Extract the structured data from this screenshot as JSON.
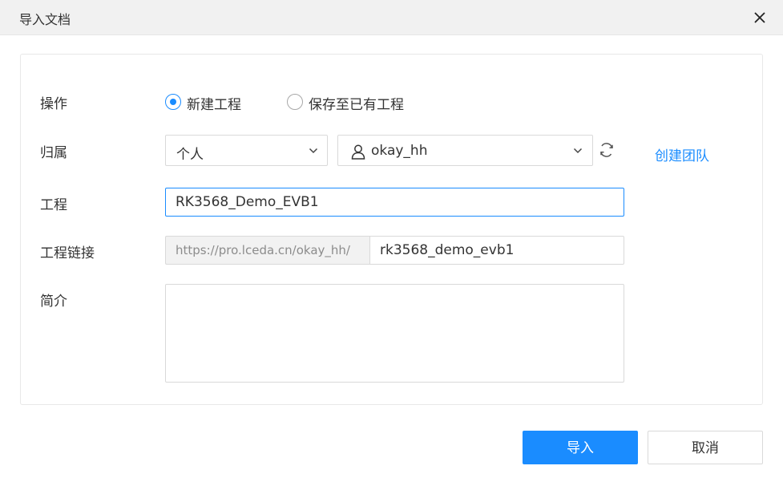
{
  "dialog": {
    "title": "导入文档",
    "close_icon": "close-icon"
  },
  "form": {
    "operation": {
      "label": "操作",
      "options": [
        {
          "label": "新建工程",
          "checked": true
        },
        {
          "label": "保存至已有工程",
          "checked": false
        }
      ]
    },
    "owner": {
      "label": "归属",
      "scope_value": "个人",
      "user_value": "okay_hh",
      "user_icon": "user-icon",
      "refresh_icon": "refresh-icon",
      "create_team_link": "创建团队"
    },
    "project": {
      "label": "工程",
      "value": "RK3568_Demo_EVB1"
    },
    "project_link": {
      "label": "工程链接",
      "prefix": "https://pro.lceda.cn/okay_hh/",
      "value": "rk3568_demo_evb1"
    },
    "description": {
      "label": "简介",
      "value": ""
    }
  },
  "footer": {
    "import_label": "导入",
    "cancel_label": "取消"
  },
  "colors": {
    "accent": "#1a8cff",
    "titlebar_bg": "#f1f1f1",
    "prefix_bg": "#f2f2f2"
  }
}
